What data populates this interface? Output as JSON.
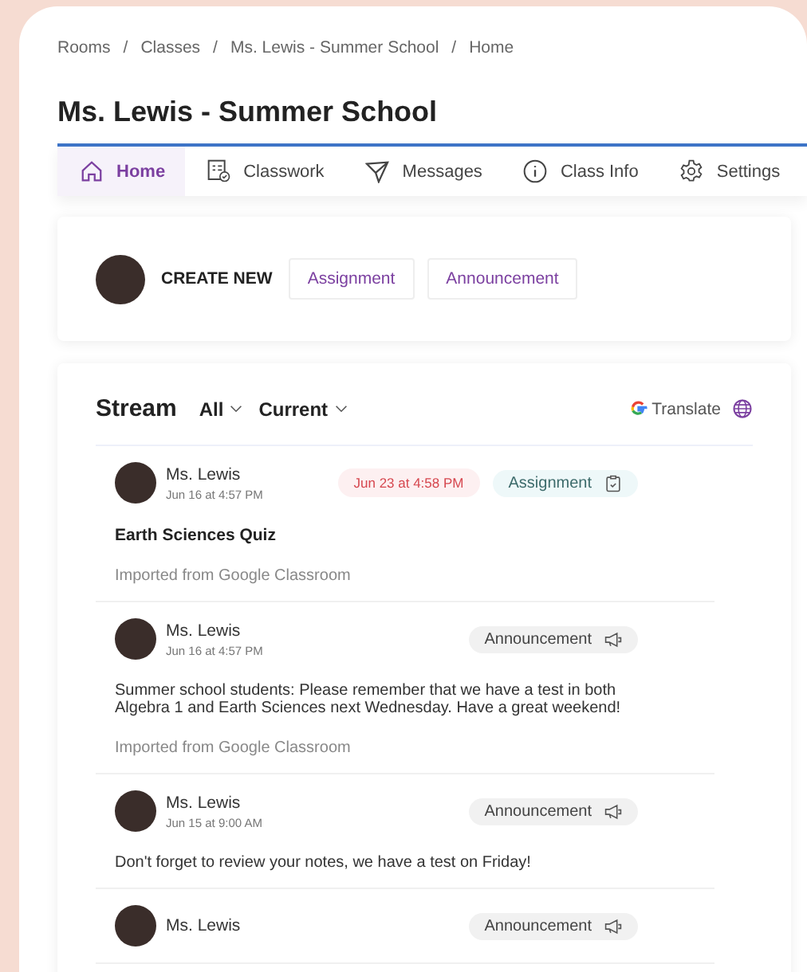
{
  "breadcrumb": {
    "separator": "/",
    "items": [
      "Rooms",
      "Classes",
      "Ms. Lewis - Summer School",
      "Home"
    ]
  },
  "title": "Ms. Lewis - Summer School",
  "tabs": [
    {
      "label": "Home",
      "kind": "home",
      "selected": true
    },
    {
      "label": "Classwork",
      "kind": "classwork",
      "selected": false
    },
    {
      "label": "Messages",
      "kind": "messages",
      "selected": false
    },
    {
      "label": "Class Info",
      "kind": "info",
      "selected": false
    },
    {
      "label": "Settings",
      "kind": "settings",
      "selected": false
    }
  ],
  "create": {
    "label": "CREATE NEW",
    "buttons": [
      "Assignment",
      "Announcement"
    ]
  },
  "stream": {
    "title": "Stream",
    "filters": [
      "All",
      "Current"
    ],
    "translate": "Translate",
    "posts": [
      {
        "author": "Ms. Lewis",
        "time": "Jun 16 at 4:57 PM",
        "due": "Jun 23 at 4:58 PM",
        "kind": "assignment",
        "type_label": "Assignment",
        "title": "Earth Sciences Quiz",
        "footer": "Imported from Google Classroom"
      },
      {
        "author": "Ms. Lewis",
        "time": "Jun 16 at 4:57 PM",
        "kind": "announcement",
        "type_label": "Announcement",
        "body": "Summer school students: Please remember that we have a test in both Algebra 1 and Earth Sciences next Wednesday. Have a great weekend!",
        "footer": "Imported from Google Classroom"
      },
      {
        "author": "Ms. Lewis",
        "time": "Jun 15 at 9:00 AM",
        "kind": "announcement",
        "type_label": "Announcement",
        "body": "Don't forget to review your notes, we have a test on Friday!"
      },
      {
        "author": "Ms. Lewis",
        "kind": "announcement",
        "type_label": "Announcement"
      }
    ]
  }
}
